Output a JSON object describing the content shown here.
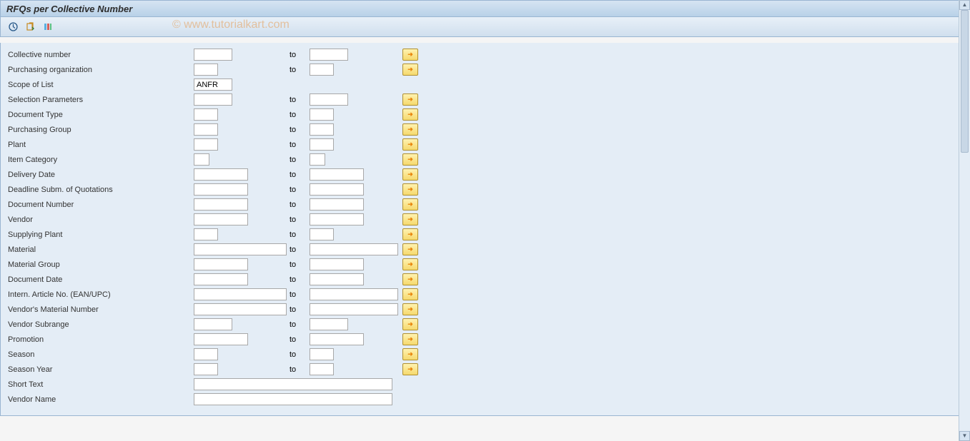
{
  "title": "RFQs per Collective Number",
  "watermark": "© www.tutorialkart.com",
  "to_label": "to",
  "fields": {
    "collective_number": {
      "label": "Collective number",
      "from": "",
      "to": ""
    },
    "purchasing_org": {
      "label": "Purchasing organization",
      "from": "",
      "to": ""
    },
    "scope_of_list": {
      "label": "Scope of List",
      "value": "ANFR"
    },
    "selection_parameters": {
      "label": "Selection Parameters",
      "from": "",
      "to": ""
    },
    "document_type": {
      "label": "Document Type",
      "from": "",
      "to": ""
    },
    "purchasing_group": {
      "label": "Purchasing Group",
      "from": "",
      "to": ""
    },
    "plant": {
      "label": "Plant",
      "from": "",
      "to": ""
    },
    "item_category": {
      "label": "Item Category",
      "from": "",
      "to": ""
    },
    "delivery_date": {
      "label": "Delivery Date",
      "from": "",
      "to": ""
    },
    "deadline_subm": {
      "label": "Deadline Subm. of Quotations",
      "from": "",
      "to": ""
    },
    "document_number": {
      "label": "Document Number",
      "from": "",
      "to": ""
    },
    "vendor": {
      "label": "Vendor",
      "from": "",
      "to": ""
    },
    "supplying_plant": {
      "label": "Supplying Plant",
      "from": "",
      "to": ""
    },
    "material": {
      "label": "Material",
      "from": "",
      "to": ""
    },
    "material_group": {
      "label": "Material Group",
      "from": "",
      "to": ""
    },
    "document_date": {
      "label": "Document Date",
      "from": "",
      "to": ""
    },
    "intern_article_no": {
      "label": "Intern. Article No. (EAN/UPC)",
      "from": "",
      "to": ""
    },
    "vendor_material_number": {
      "label": "Vendor's Material Number",
      "from": "",
      "to": ""
    },
    "vendor_subrange": {
      "label": "Vendor Subrange",
      "from": "",
      "to": ""
    },
    "promotion": {
      "label": "Promotion",
      "from": "",
      "to": ""
    },
    "season": {
      "label": "Season",
      "from": "",
      "to": ""
    },
    "season_year": {
      "label": "Season Year",
      "from": "",
      "to": ""
    },
    "short_text": {
      "label": "Short Text",
      "value": ""
    },
    "vendor_name": {
      "label": "Vendor Name",
      "value": ""
    }
  }
}
